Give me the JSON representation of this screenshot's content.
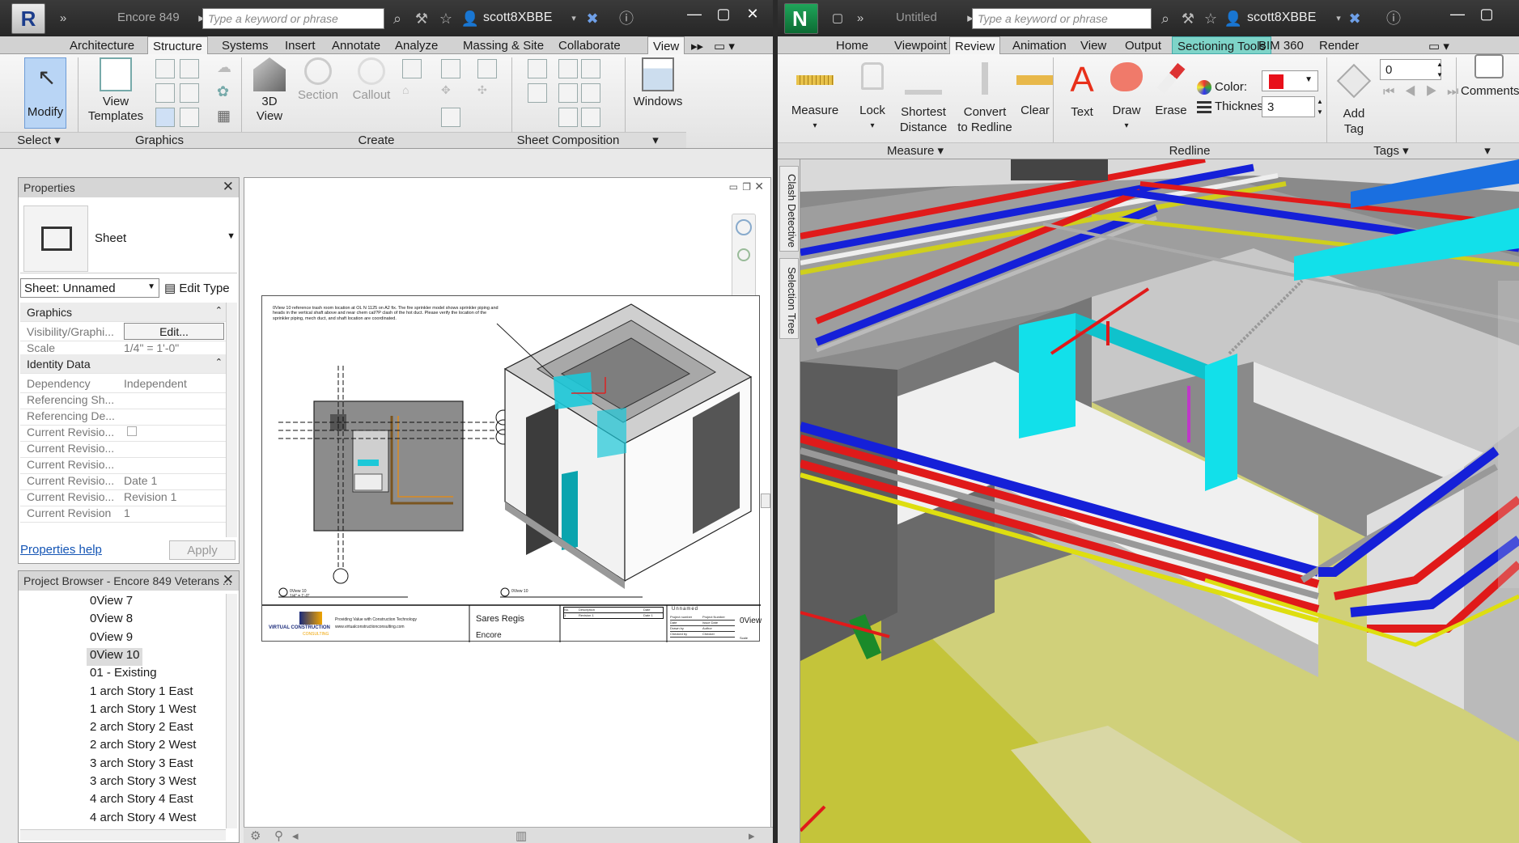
{
  "revit": {
    "title": "Encore 849",
    "search_placeholder": "Type a keyword or phrase",
    "user": "scott8XBBE",
    "tabs": [
      "Architecture",
      "Structure",
      "Systems",
      "Insert",
      "Annotate",
      "Analyze",
      "Massing & Site",
      "Collaborate",
      "View"
    ],
    "active_tab": "View",
    "ribbon": {
      "modify": "Modify",
      "view_templates": [
        "View",
        "Templates"
      ],
      "three_d_view": [
        "3D",
        "View"
      ],
      "section": "Section",
      "callout": "Callout",
      "windows": "Windows",
      "panels": {
        "select": "Select",
        "graphics": "Graphics",
        "create": "Create",
        "sheet_composition": "Sheet Composition"
      }
    },
    "properties": {
      "header": "Properties",
      "type": "Sheet",
      "instance_selector": "Sheet: Unnamed",
      "edit_type": "Edit Type",
      "groups": {
        "graphics": "Graphics",
        "identity": "Identity Data"
      },
      "rows": [
        {
          "k": "Visibility/Graphi...",
          "v": "Edit..."
        },
        {
          "k": "Scale",
          "v": "1/4\" = 1'-0\""
        },
        {
          "k": "Dependency",
          "v": "Independent"
        },
        {
          "k": "Referencing Sh...",
          "v": ""
        },
        {
          "k": "Referencing De...",
          "v": ""
        },
        {
          "k": "Current Revisio...",
          "v": ""
        },
        {
          "k": "Current Revisio...",
          "v": ""
        },
        {
          "k": "Current Revisio...",
          "v": ""
        },
        {
          "k": "Current Revisio...",
          "v": "Date 1"
        },
        {
          "k": "Current Revisio...",
          "v": "Revision 1"
        },
        {
          "k": "Current Revision",
          "v": "1"
        }
      ],
      "help_link": "Properties help",
      "apply": "Apply"
    },
    "browser": {
      "header": "Project Browser - Encore 849 Veterans ...",
      "items": [
        "0View 7",
        "0View 8",
        "0View 9",
        "0View 10",
        "01 - Existing",
        "1 arch Story 1 East",
        "1 arch Story 1 West",
        "2 arch Story 2 East",
        "2 arch Story 2 West",
        "3 arch Story 3 East",
        "3 arch Story 3 West",
        "4 arch Story 4 East",
        "4 arch Story 4 West"
      ],
      "selected": "0View 10"
    },
    "sheet": {
      "note": "0View 10 reference trash room location at OL N 1125 on A2 fix. The fire sprinkler model shows sprinkler piping and heads in the vertical shaft above and near chem cal/?P clash of the hot duct. Please verify the location of the sprinkler piping, mech duct, and shaft location are coordinated.",
      "view_label_left": "0View 10",
      "view_label_left_scale": "1/4\" = 1'-0\"",
      "view_label_right": "0View 10",
      "company_tagline": "Providing Value with Construction Technology",
      "company_url": "www.virtualconstructionconsulting.com",
      "logo_text": "VIRTUAL CONSTRUCTION",
      "logo_sub": "CONSULTING",
      "project_line1": "Sares Regis",
      "project_line2": "Encore",
      "rev_headers": [
        "No.",
        "Description",
        "Date"
      ],
      "rev_row": [
        "1",
        "Revision 1",
        "Date 1"
      ],
      "sheet_name": "Unnamed",
      "info_labels": [
        "Project number",
        "Date",
        "Drawn by",
        "Checked by"
      ],
      "info_values": [
        "Project Number",
        "Issue Date",
        "Author",
        "Checker"
      ],
      "sheet_number": "0View",
      "scale_label": "Scale"
    }
  },
  "navisworks": {
    "title": "Untitled",
    "search_placeholder": "Type a keyword or phrase",
    "user": "scott8XBBE",
    "tabs": [
      "Home",
      "Viewpoint",
      "Review",
      "Animation",
      "View",
      "Output",
      "Sectioning Tools",
      "BIM 360",
      "Render"
    ],
    "active_tab": "Review",
    "ribbon": {
      "measure": "Measure",
      "lock": "Lock",
      "shortest_distance": [
        "Shortest",
        "Distance"
      ],
      "convert_to_redline": [
        "Convert",
        "to Redline"
      ],
      "clear": "Clear",
      "text": "Text",
      "draw": "Draw",
      "erase": "Erase",
      "color_label": "Color:",
      "thickness_label": "Thickness:",
      "thickness_value": "3",
      "add_tag": [
        "Add",
        "Tag"
      ],
      "tag_value": "0",
      "comments": "Comments",
      "panels": {
        "measure": "Measure",
        "redline": "Redline",
        "tags": "Tags"
      }
    },
    "side_tabs": [
      "Clash Detective",
      "Selection Tree"
    ]
  },
  "colors": {
    "redline": "#e8101a",
    "pipe_blue": "#1520d8",
    "pipe_red": "#e01a1a",
    "cyan": "#12e0ea",
    "yellow": "#d6d62a"
  }
}
